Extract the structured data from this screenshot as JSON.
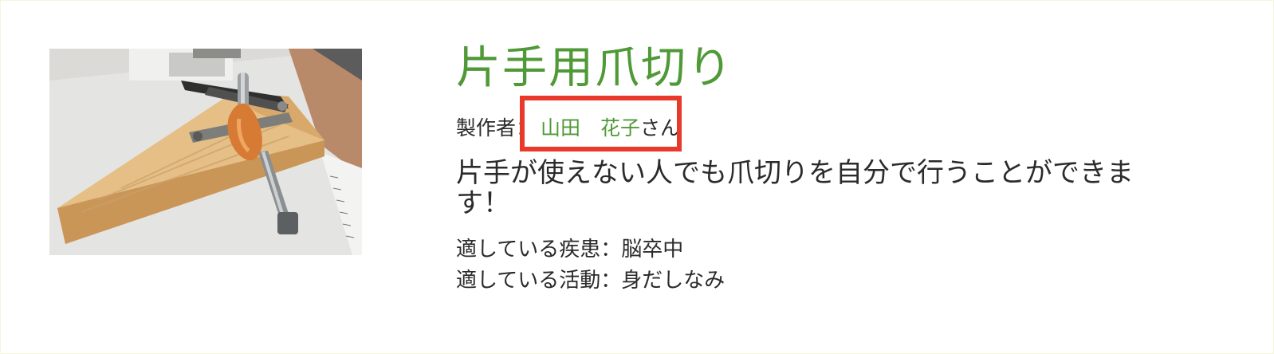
{
  "product": {
    "title": "片手用爪切り",
    "maker_label": "製作者：",
    "maker_name": "山田　花子",
    "maker_suffix": "さん",
    "description": "片手が使えない人でも爪切りを自分で行うことができます！",
    "disease_label": "適している疾患：",
    "disease_value": "脳卒中",
    "activity_label": "適している活動：",
    "activity_value": "身だしなみ"
  },
  "colors": {
    "accent_green": "#4f9a37",
    "highlight_red": "#e8392b",
    "text": "#2b2b2b"
  }
}
